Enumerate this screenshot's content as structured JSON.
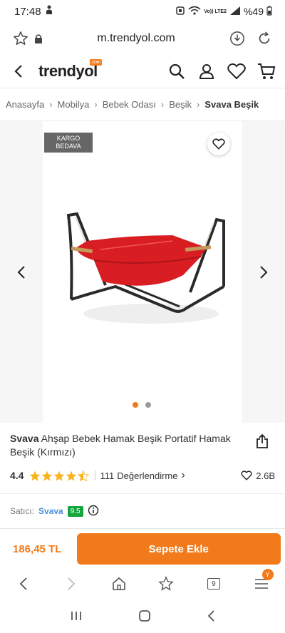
{
  "status_bar": {
    "time": "17:48",
    "network": "Vo)) LTE2",
    "battery": "%49"
  },
  "browser": {
    "url": "m.trendyol.com"
  },
  "header": {
    "logo": "trendyol",
    "logo_badge": ".com"
  },
  "breadcrumb": {
    "items": [
      "Anasayfa",
      "Mobilya",
      "Bebek Odası",
      "Beşik"
    ],
    "current": "Svava Beşik"
  },
  "gallery": {
    "badge_line1": "KARGO",
    "badge_line2": "BEDAVA",
    "image_count": 2,
    "active_index": 0
  },
  "product": {
    "brand": "Svava",
    "name": "Ahşap Bebek Hamak Beşik Portatif Hamak Beşik (Kırmızı)",
    "rating": "4.4",
    "rating_value": 4.4,
    "review_count": "111",
    "review_label": "Değerlendirme",
    "favorites": "2.6B"
  },
  "seller": {
    "label": "Satıcı:",
    "name": "Svava",
    "score": "9.5"
  },
  "buy": {
    "price": "186,45 TL",
    "add_to_cart": "Sepete Ekle"
  },
  "browser_nav": {
    "tabs_count": "9",
    "menu_badge": "Y"
  },
  "colors": {
    "accent": "#f27a1a",
    "seller_score": "#14a63d",
    "product": "#d81e22"
  }
}
